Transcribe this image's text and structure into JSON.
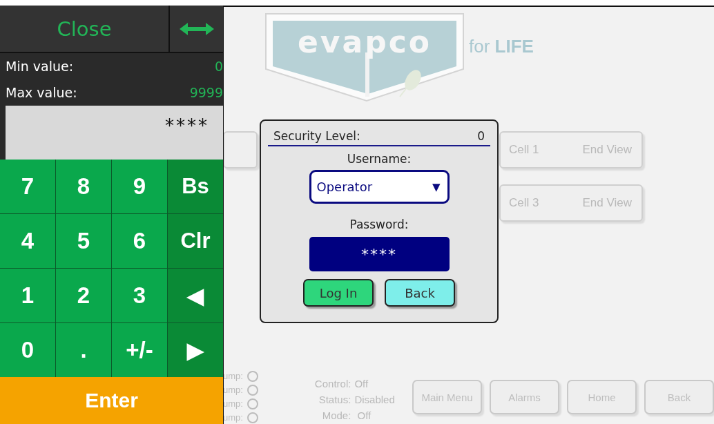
{
  "logo": {
    "wordmark": "evapco",
    "tagline_light": "for",
    "tagline_bold": "LIFE"
  },
  "cell_rows": [
    [
      {
        "kind": "blank"
      },
      {
        "kind": "cell",
        "cell": "Cell 1",
        "view": "End View"
      }
    ],
    [
      {
        "kind": "cell",
        "cell": "Cell 3",
        "view": "End View"
      }
    ]
  ],
  "pumps": [
    {
      "label": "ump:",
      "on": false
    },
    {
      "label": "ump:",
      "on": false
    },
    {
      "label": "ump:",
      "on": false
    },
    {
      "label": "ump:",
      "on": false
    }
  ],
  "status": [
    {
      "label": "Control:",
      "value": "Off"
    },
    {
      "label": "Status:",
      "value": "Disabled"
    },
    {
      "label": "Mode:",
      "value": " Off"
    }
  ],
  "nav_buttons": [
    "Main Menu",
    "Alarms",
    "Home",
    "Back"
  ],
  "keypad": {
    "close": "Close",
    "min_label": "Min value:",
    "min_value": "0",
    "max_label": "Max value:",
    "max_value": "9999",
    "display": "****",
    "keys": [
      {
        "label": "7",
        "kind": "digit"
      },
      {
        "label": "8",
        "kind": "digit"
      },
      {
        "label": "9",
        "kind": "digit"
      },
      {
        "label": "Bs",
        "kind": "action"
      },
      {
        "label": "4",
        "kind": "digit"
      },
      {
        "label": "5",
        "kind": "digit"
      },
      {
        "label": "6",
        "kind": "digit"
      },
      {
        "label": "Clr",
        "kind": "action"
      },
      {
        "label": "1",
        "kind": "digit"
      },
      {
        "label": "2",
        "kind": "digit"
      },
      {
        "label": "3",
        "kind": "digit"
      },
      {
        "label": "◀",
        "kind": "action"
      },
      {
        "label": "0",
        "kind": "digit"
      },
      {
        "label": ".",
        "kind": "digit"
      },
      {
        "label": "+/-",
        "kind": "digit"
      },
      {
        "label": "▶",
        "kind": "action"
      }
    ],
    "enter": "Enter"
  },
  "login_dialog": {
    "security_label": "Security Level:",
    "security_value": "0",
    "username_label": "Username:",
    "username": "Operator",
    "dropdown_caret": "▼",
    "password_label": "Password:",
    "password": "****",
    "buttons": [
      {
        "label": "Log In",
        "kind": "primary"
      },
      {
        "label": "Back",
        "kind": "secondary"
      }
    ]
  }
}
